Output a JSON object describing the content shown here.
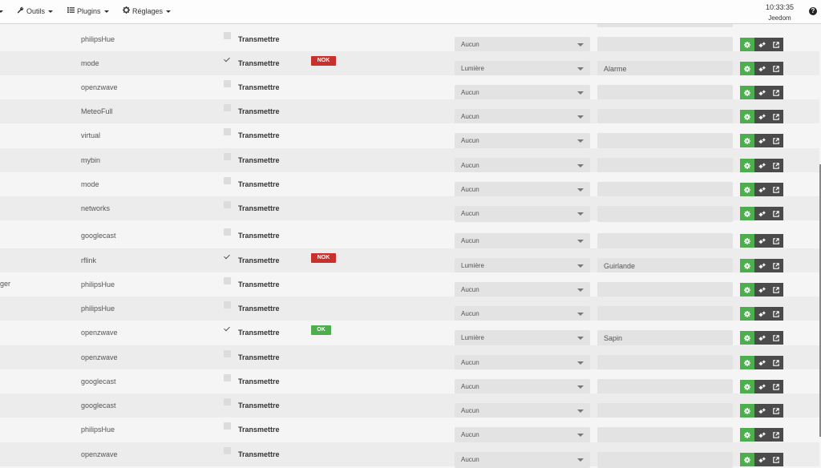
{
  "navbar": {
    "items": [
      {
        "label": "Outils",
        "icon": "wrench-icon"
      },
      {
        "label": "Plugins",
        "icon": "list-icon"
      },
      {
        "label": "Réglages",
        "icon": "gear-icon"
      }
    ],
    "time": "10:33:35",
    "name": "Jeedom",
    "help_icon": "question-circle-icon"
  },
  "colors": {
    "green": "#4cae4c",
    "red": "#c9302c",
    "dark": "#4b4b4b"
  },
  "rows": [
    {
      "left": "",
      "plugin": "philipsHue",
      "checked": false,
      "transmit": "Transmettre",
      "status": "",
      "type": "Aucun",
      "value": ""
    },
    {
      "left": "",
      "plugin": "mode",
      "checked": true,
      "transmit": "Transmettre",
      "status": "NOK",
      "type": "Lumière",
      "value": "Alarme"
    },
    {
      "left": "",
      "plugin": "openzwave",
      "checked": false,
      "transmit": "Transmettre",
      "status": "",
      "type": "Aucun",
      "value": ""
    },
    {
      "left": "",
      "plugin": "MeteoFull",
      "checked": false,
      "transmit": "Transmettre",
      "status": "",
      "type": "Aucun",
      "value": ""
    },
    {
      "left": "",
      "plugin": "virtual",
      "checked": false,
      "transmit": "Transmettre",
      "status": "",
      "type": "Aucun",
      "value": ""
    },
    {
      "left": "",
      "plugin": "mybin",
      "checked": false,
      "transmit": "Transmettre",
      "status": "",
      "type": "Aucun",
      "value": ""
    },
    {
      "left": "",
      "plugin": "mode",
      "checked": false,
      "transmit": "Transmettre",
      "status": "",
      "type": "Aucun",
      "value": ""
    },
    {
      "left": "",
      "plugin": "networks",
      "checked": false,
      "transmit": "Transmettre",
      "status": "",
      "type": "Aucun",
      "value": ""
    },
    {
      "left": "",
      "plugin": "googlecast",
      "checked": false,
      "transmit": "Transmettre",
      "status": "",
      "type": "Aucun",
      "value": ""
    },
    {
      "left": "",
      "plugin": "rflink",
      "checked": true,
      "transmit": "Transmettre",
      "status": "NOK",
      "type": "Lumière",
      "value": "Guirlande"
    },
    {
      "left": "ger",
      "plugin": "philipsHue",
      "checked": false,
      "transmit": "Transmettre",
      "status": "",
      "type": "Aucun",
      "value": ""
    },
    {
      "left": "",
      "plugin": "philipsHue",
      "checked": false,
      "transmit": "Transmettre",
      "status": "",
      "type": "Aucun",
      "value": ""
    },
    {
      "left": "",
      "plugin": "openzwave",
      "checked": true,
      "transmit": "Transmettre",
      "status": "OK",
      "type": "Lumière",
      "value": "Sapin"
    },
    {
      "left": "",
      "plugin": "openzwave",
      "checked": false,
      "transmit": "Transmettre",
      "status": "",
      "type": "Aucun",
      "value": ""
    },
    {
      "left": "",
      "plugin": "googlecast",
      "checked": false,
      "transmit": "Transmettre",
      "status": "",
      "type": "Aucun",
      "value": ""
    },
    {
      "left": "",
      "plugin": "googlecast",
      "checked": false,
      "transmit": "Transmettre",
      "status": "",
      "type": "Aucun",
      "value": ""
    },
    {
      "left": "",
      "plugin": "philipsHue",
      "checked": false,
      "transmit": "Transmettre",
      "status": "",
      "type": "Aucun",
      "value": ""
    },
    {
      "left": "",
      "plugin": "openzwave",
      "checked": false,
      "transmit": "Transmettre",
      "status": "",
      "type": "Aucun",
      "value": ""
    }
  ]
}
